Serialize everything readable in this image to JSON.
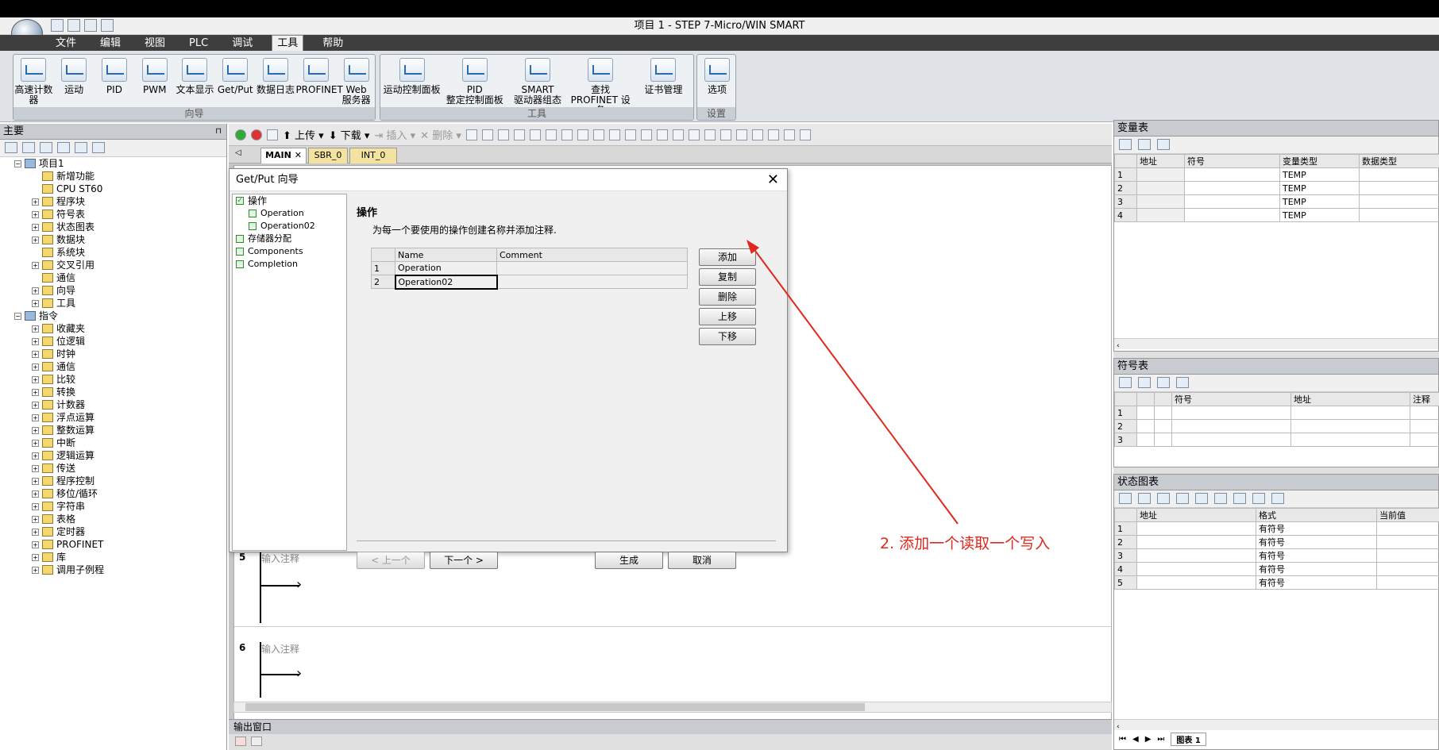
{
  "window": {
    "title": "项目 1 - STEP 7-Micro/WIN SMART"
  },
  "menu": [
    "文件",
    "编辑",
    "视图",
    "PLC",
    "调试",
    "工具",
    "帮助"
  ],
  "menu_active": "工具",
  "ribbon": {
    "groups": [
      {
        "label": "向导",
        "buttons": [
          "高速计数器",
          "运动",
          "PID",
          "PWM",
          "文本显示",
          "Get/Put",
          "数据日志",
          "PROFINET",
          "Web\n服务器"
        ]
      },
      {
        "label": "工具",
        "buttons": [
          "运动控制面板",
          "PID\n整定控制面板",
          "SMART\n驱动器组态",
          "查找\nPROFINET 设备",
          "证书管理"
        ]
      },
      {
        "label": "设置",
        "buttons": [
          "选项"
        ]
      }
    ]
  },
  "left_panel": {
    "title": "主要",
    "tree": [
      {
        "label": "项目1",
        "level": 0,
        "pm": "−"
      },
      {
        "label": "新增功能",
        "level": 1,
        "pm": ""
      },
      {
        "label": "CPU ST60",
        "level": 1,
        "pm": ""
      },
      {
        "label": "程序块",
        "level": 1,
        "pm": "+"
      },
      {
        "label": "符号表",
        "level": 1,
        "pm": "+"
      },
      {
        "label": "状态图表",
        "level": 1,
        "pm": "+"
      },
      {
        "label": "数据块",
        "level": 1,
        "pm": "+"
      },
      {
        "label": "系统块",
        "level": 1,
        "pm": ""
      },
      {
        "label": "交叉引用",
        "level": 1,
        "pm": "+"
      },
      {
        "label": "通信",
        "level": 1,
        "pm": ""
      },
      {
        "label": "向导",
        "level": 1,
        "pm": "+"
      },
      {
        "label": "工具",
        "level": 1,
        "pm": "+"
      },
      {
        "label": "指令",
        "level": 0,
        "pm": "−"
      },
      {
        "label": "收藏夹",
        "level": 1,
        "pm": "+"
      },
      {
        "label": "位逻辑",
        "level": 1,
        "pm": "+"
      },
      {
        "label": "时钟",
        "level": 1,
        "pm": "+"
      },
      {
        "label": "通信",
        "level": 1,
        "pm": "+"
      },
      {
        "label": "比较",
        "level": 1,
        "pm": "+"
      },
      {
        "label": "转换",
        "level": 1,
        "pm": "+"
      },
      {
        "label": "计数器",
        "level": 1,
        "pm": "+"
      },
      {
        "label": "浮点运算",
        "level": 1,
        "pm": "+"
      },
      {
        "label": "整数运算",
        "level": 1,
        "pm": "+"
      },
      {
        "label": "中断",
        "level": 1,
        "pm": "+"
      },
      {
        "label": "逻辑运算",
        "level": 1,
        "pm": "+"
      },
      {
        "label": "传送",
        "level": 1,
        "pm": "+"
      },
      {
        "label": "程序控制",
        "level": 1,
        "pm": "+"
      },
      {
        "label": "移位/循环",
        "level": 1,
        "pm": "+"
      },
      {
        "label": "字符串",
        "level": 1,
        "pm": "+"
      },
      {
        "label": "表格",
        "level": 1,
        "pm": "+"
      },
      {
        "label": "定时器",
        "level": 1,
        "pm": "+"
      },
      {
        "label": "PROFINET",
        "level": 1,
        "pm": "+"
      },
      {
        "label": "库",
        "level": 1,
        "pm": "+"
      },
      {
        "label": "调用子例程",
        "level": 1,
        "pm": "+"
      }
    ]
  },
  "editor": {
    "toolbar": {
      "upload": "上传",
      "download": "下载",
      "insert": "插入",
      "delete": "删除"
    },
    "tabs": [
      "MAIN",
      "SBR_0",
      "INT_0"
    ],
    "networks": [
      {
        "num": "5",
        "comment": "输入注释"
      },
      {
        "num": "6",
        "comment": "输入注释"
      }
    ],
    "output_window": "输出窗口"
  },
  "dialog": {
    "title": "Get/Put 向导",
    "nav": [
      {
        "label": "操作",
        "level": 0
      },
      {
        "label": "Operation",
        "level": 1
      },
      {
        "label": "Operation02",
        "level": 1
      },
      {
        "label": "存储器分配",
        "level": 0
      },
      {
        "label": "Components",
        "level": 0
      },
      {
        "label": "Completion",
        "level": 0
      }
    ],
    "heading": "操作",
    "description": "为每一个要使用的操作创建名称并添加注释.",
    "columns": [
      "Name",
      "Comment"
    ],
    "rows": [
      {
        "n": "1",
        "name": "Operation",
        "comment": ""
      },
      {
        "n": "2",
        "name": "Operation02",
        "comment": ""
      }
    ],
    "side_buttons": [
      "添加",
      "复制",
      "删除",
      "上移",
      "下移"
    ],
    "footer": {
      "prev": "< 上一个",
      "next": "下一个 >",
      "generate": "生成",
      "cancel": "取消"
    }
  },
  "var_table": {
    "title": "变量表",
    "columns": [
      "地址",
      "符号",
      "变量类型",
      "数据类型"
    ],
    "rows": [
      {
        "n": "1",
        "type": "TEMP"
      },
      {
        "n": "2",
        "type": "TEMP"
      },
      {
        "n": "3",
        "type": "TEMP"
      },
      {
        "n": "4",
        "type": "TEMP"
      }
    ]
  },
  "symbol_table": {
    "title": "符号表",
    "columns": [
      "符号",
      "地址",
      "注释"
    ],
    "rows": [
      "1",
      "2",
      "3"
    ]
  },
  "status_table": {
    "title": "状态图表",
    "columns": [
      "地址",
      "格式",
      "当前值"
    ],
    "rows": [
      {
        "n": "1",
        "format": "有符号"
      },
      {
        "n": "2",
        "format": "有符号"
      },
      {
        "n": "3",
        "format": "有符号"
      },
      {
        "n": "4",
        "format": "有符号"
      },
      {
        "n": "5",
        "format": "有符号"
      }
    ],
    "tab": "图表 1"
  },
  "annotation": {
    "text": "2. 添加一个读取一个写入",
    "color": "#e0281e"
  }
}
